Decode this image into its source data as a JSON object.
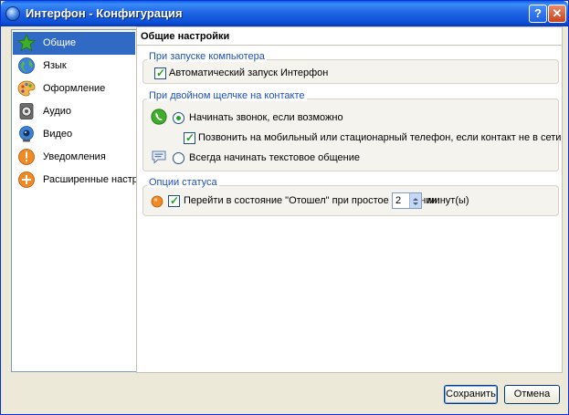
{
  "window": {
    "title": "Интерфон - Конфигурация",
    "help_glyph": "?",
    "close_glyph": "✕"
  },
  "sidebar": {
    "items": [
      {
        "label": "Общие",
        "icon": "star-icon",
        "selected": true
      },
      {
        "label": "Язык",
        "icon": "globe-icon",
        "selected": false
      },
      {
        "label": "Оформление",
        "icon": "palette-icon",
        "selected": false
      },
      {
        "label": "Аудио",
        "icon": "speaker-icon",
        "selected": false
      },
      {
        "label": "Видео",
        "icon": "webcam-icon",
        "selected": false
      },
      {
        "label": "Уведомления",
        "icon": "alert-icon",
        "selected": false
      },
      {
        "label": "Расширенные настройки",
        "icon": "plus-icon",
        "selected": false
      }
    ]
  },
  "panel": {
    "title": "Общие настройки",
    "startup": {
      "title": "При запуске компьютера",
      "autostart_label": "Автоматический запуск Интерфон",
      "autostart_checked": true
    },
    "doubleclick": {
      "title": "При двойном щелчке на контакте",
      "call_label": "Начинать звонок, если возможно",
      "call_selected": true,
      "mobile_label": "Позвонить на мобильный или стационарный телефон, если контакт не в сети",
      "mobile_checked": true,
      "text_label": "Всегда начинать текстовое общение",
      "text_selected": false
    },
    "status": {
      "title": "Опции статуса",
      "away_label": "Перейти в состояние \"Отошел\" при простое в течении:",
      "away_checked": true,
      "away_minutes": "2",
      "minutes_suffix": "минут(ы)"
    }
  },
  "footer": {
    "save_label": "Сохранить",
    "cancel_label": "Отмена"
  }
}
